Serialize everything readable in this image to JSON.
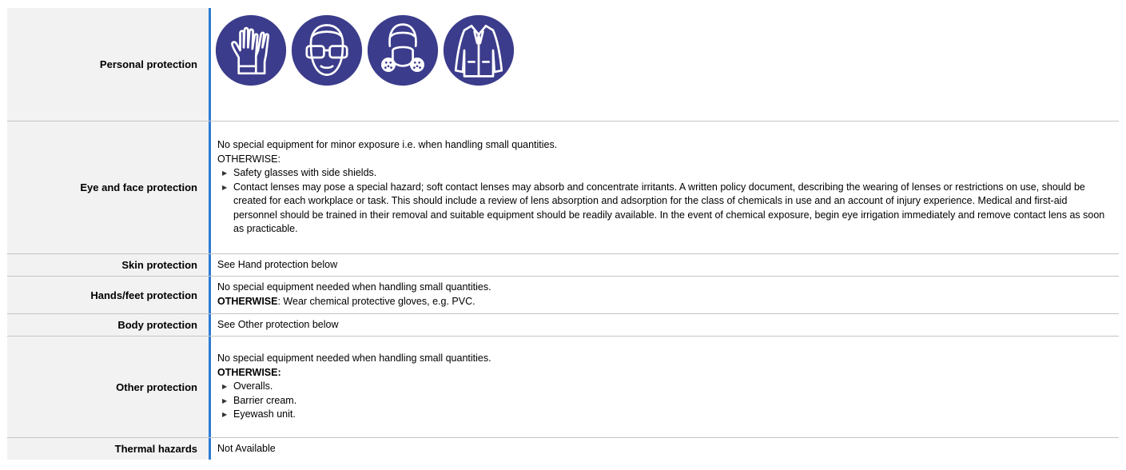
{
  "rows": {
    "personal": {
      "label": "Personal protection",
      "icons": [
        "gloves-icon",
        "safety-glasses-icon",
        "respirator-icon",
        "lab-coat-icon"
      ]
    },
    "eye": {
      "label": "Eye and face protection",
      "intro": "No special equipment for minor exposure i.e. when handling small quantities.",
      "otherwise": "OTHERWISE:",
      "items": [
        "Safety glasses with side shields.",
        "Contact lenses may pose a special hazard; soft contact lenses may absorb and concentrate irritants. A written policy document, describing the wearing of lenses or restrictions on use, should be created for each workplace or task. This should include a review of lens absorption and adsorption for the class of chemicals in use and an account of injury experience. Medical and first-aid personnel should be trained in their removal and suitable equipment should be readily available. In the event of chemical exposure, begin eye irrigation immediately and remove contact lens as soon as practicable."
      ]
    },
    "skin": {
      "label": "Skin protection",
      "value": "See Hand protection below"
    },
    "hands": {
      "label": "Hands/feet protection",
      "line1": "No special equipment needed when handling small quantities.",
      "otherwise": "OTHERWISE",
      "line2_rest": ": Wear chemical protective gloves, e.g. PVC."
    },
    "body": {
      "label": "Body protection",
      "value": "See Other protection below"
    },
    "other": {
      "label": "Other protection",
      "line1": "No special equipment needed when handling small quantities.",
      "otherwise": "OTHERWISE:",
      "items": [
        "Overalls.",
        "Barrier cream.",
        "Eyewash unit."
      ]
    },
    "thermal": {
      "label": "Thermal hazards",
      "value": "Not Available"
    }
  },
  "colors": {
    "icon_fill": "#3c3c8c",
    "accent_border": "#2d7bd3",
    "label_bg": "#f2f2f2"
  }
}
